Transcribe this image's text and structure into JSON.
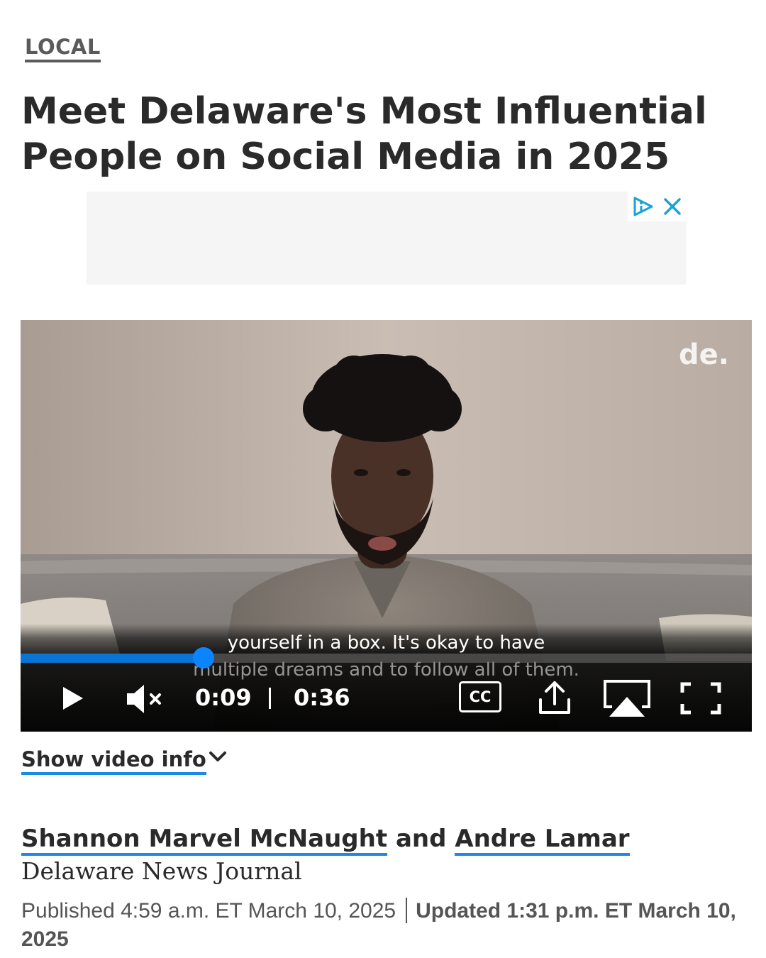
{
  "section": {
    "label": "LOCAL"
  },
  "headline": "Meet Delaware's Most Influential People on Social Media in 2025",
  "ad": {
    "adchoices_icon": "adchoices-icon",
    "close_icon": "close-icon"
  },
  "video": {
    "brand_mark": "de.",
    "caption_line1": "yourself in a box. It's okay to have",
    "caption_line2": "multiple dreams and to follow all of them.",
    "current_time": "0:09",
    "duration": "0:36",
    "progress_fraction": 0.25,
    "controls": {
      "play_icon": "play-icon",
      "mute_icon": "muted-speaker-icon",
      "cc_label": "CC",
      "share_icon": "share-icon",
      "airplay_icon": "airplay-icon",
      "fullscreen_icon": "fullscreen-icon"
    },
    "accent_color": "#0a84ff"
  },
  "show_video_info": {
    "label": "Show video info",
    "icon": "chevron-down-icon"
  },
  "byline": {
    "author1": "Shannon Marvel McNaught",
    "conjunction": "and",
    "author2": "Andre Lamar",
    "publication": "Delaware News Journal"
  },
  "dates": {
    "published": "Published 4:59 a.m. ET March 10, 2025",
    "updated": "Updated 1:31 p.m. ET March 10, 2025"
  },
  "colors": {
    "link_underline": "#1a8ae6",
    "headline_text": "#2a2a2a"
  }
}
